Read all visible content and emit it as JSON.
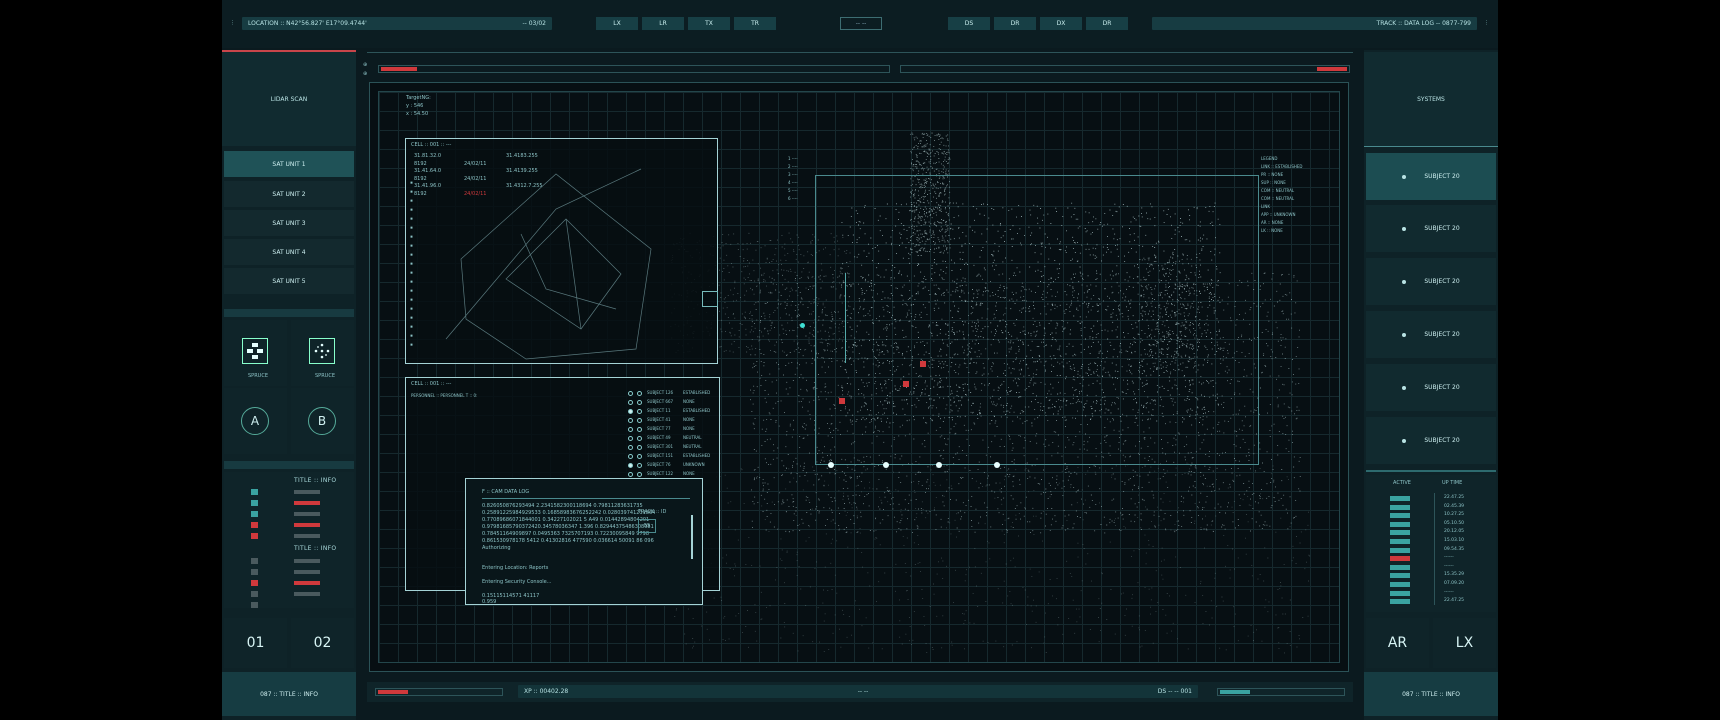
{
  "topbar": {
    "location_label": "LOCATION :: N42°56.827' E17°09.4744'",
    "location_code": "-- 03/02",
    "buttons_left": [
      "LX",
      "LR",
      "TX",
      "TR"
    ],
    "center_box": "-- --",
    "buttons_right": [
      "DS",
      "DR",
      "DX",
      "DR"
    ],
    "track_label": "TRACK :: DATA LOG -- 0877-799"
  },
  "left": {
    "header": "LIDAR SCAN",
    "sat_units": [
      "SAT UNIT 1",
      "SAT UNIT 2",
      "SAT UNIT 3",
      "SAT UNIT 4",
      "SAT UNIT 5"
    ],
    "icon_labels": [
      "SPRUCE",
      "SPRUCE"
    ],
    "letter_a": "A",
    "letter_b": "B",
    "info_title_1": "TITLE :: INFO",
    "info_title_2": "TITLE :: INFO",
    "num_1": "01",
    "num_2": "02",
    "footer": "087 :: TITLE :: INFO"
  },
  "right": {
    "header": "SYSTEMS",
    "subjects": [
      "SUBJECT 20",
      "SUBJECT 20",
      "SUBJECT 20",
      "SUBJECT 20",
      "SUBJECT 20",
      "SUBJECT 20"
    ],
    "col_active": "ACTIVE",
    "col_uptime": "UP TIME",
    "uptimes": [
      "22.47.25",
      "02.45.39",
      "10.27.25",
      "05.10.50",
      "20.12.05",
      "15.03.10",
      "09.54.35",
      "------",
      "------",
      "15.35.29",
      "07.09.20",
      "------",
      "22.47.25"
    ],
    "ar": "AR",
    "lx": "LX",
    "footer": "087 :: TITLE :: INFO"
  },
  "viewer": {
    "target_label": "TargetNG:",
    "target_y": "y : 546",
    "target_x": "x : 54.50",
    "cell1": "CELL :: 001 :: ---",
    "cell1_rows": [
      [
        "31.81.32.0",
        "",
        "31.4183.255"
      ],
      [
        "8192",
        "24/02/11",
        ""
      ],
      [
        "31.41.64.0",
        "",
        "31.4139.255"
      ],
      [
        "8192",
        "24/02/11",
        ""
      ],
      [
        "31.41.96.0",
        "",
        "31.4312.7.255"
      ],
      [
        "8192",
        "24/02/11",
        ""
      ]
    ],
    "cell2": "CELL :: 001 :: ---",
    "cell2_sub": "PERSONNEL :: PERSONNEL T :: 0:",
    "subjects_list": [
      [
        "SUBJECT 126",
        "ESTABLISHED"
      ],
      [
        "SUBJECT 667",
        "NONE"
      ],
      [
        "SUBJECT 11",
        "ESTABLISHED"
      ],
      [
        "SUBJECT 41",
        "NONE"
      ],
      [
        "SUBJECT 77",
        "NONE"
      ],
      [
        "SUBJECT 49",
        "NEUTRAL"
      ],
      [
        "SUBJECT 301",
        "NEUTRAL"
      ],
      [
        "SUBJECT 151",
        "ESTABLISHED"
      ],
      [
        "SUBJECT 76",
        "UNKNOWN"
      ],
      [
        "SUBJECT 122",
        "NONE"
      ]
    ],
    "camlog_title": "F :: CAM DATA LOG",
    "camlog_lines": [
      "0.826050876293494 2.2341582300118694 0.79811283631735",
      "0.25891225984929533 0.16858983676252242 0.028039741231864",
      "0.77089686071844001 0.34227102021 5 A49 0.01442894804201",
      "0.97981685790372420.34578036347 1.396 0.82944375486308081",
      "0.78451164909897 0.0495363 7325707193 0.72230095849 9798",
      "0.861530978178 5412 0.41302816 477590 0.036614 50091 86 096",
      "Authorizing"
    ],
    "camlog_extra": [
      "Entering Location: Reports",
      "Entering Security Console...",
      "0.15115114571 41117",
      "0.959"
    ],
    "track_id": "TRACK :: ID",
    "track_val": "55",
    "legend_lines": [
      "LEGEND",
      "LINK :: ESTABLISHED",
      "PR :: NONE",
      "SUP :: NONE",
      "COM :: NEUTRAL",
      "COM :: NEUTRAL",
      "LINK",
      "APP :: UNKNOWN",
      "AR :: NONE",
      "LK :: NONE"
    ],
    "left_scale": [
      "1 ----",
      "2 ----",
      "3 ----",
      "4 ----",
      "5 ----",
      "6 ----"
    ]
  },
  "bottombar": {
    "xp": "XP :: 00402.28",
    "mid": "-- --",
    "ds": "DS -- -- 001"
  },
  "colors": {
    "accent": "#1f5257",
    "alert": "#d0393c",
    "teal": "#3aa3a1",
    "grey": "#4a5a5e"
  }
}
